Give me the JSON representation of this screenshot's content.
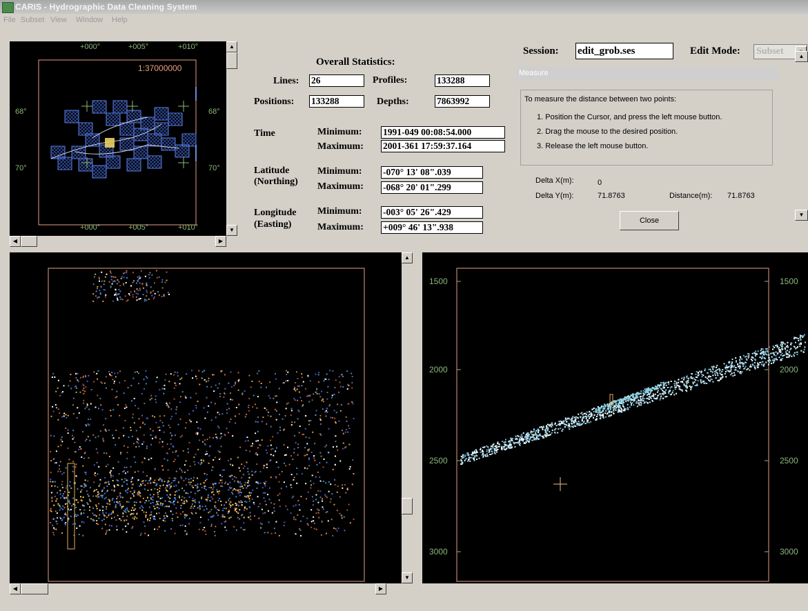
{
  "window": {
    "title": "CARIS - Hydrographic Data Cleaning System"
  },
  "menu": [
    "File",
    "Subset",
    "View",
    "Window",
    "Help"
  ],
  "overview": {
    "lon_labels": [
      "+000°",
      "+005°",
      "+010°"
    ],
    "lat_labels": [
      "68°",
      "70°"
    ],
    "scale": "1:37000000"
  },
  "stats": {
    "title": "Overall Statistics:",
    "lines_label": "Lines:",
    "lines": "26",
    "profiles_label": "Profiles:",
    "profiles": "133288",
    "positions_label": "Positions:",
    "positions": "133288",
    "depths_label": "Depths:",
    "depths": "7863992",
    "time_label": "Time",
    "latitude_label": "Latitude",
    "latitude_sub": "(Northing)",
    "longitude_label": "Longitude",
    "longitude_sub": "(Easting)",
    "min_label": "Minimum:",
    "max_label": "Maximum:",
    "time_min": "1991-049 00:08:54.000",
    "time_max": "2001-361 17:59:37.164",
    "lat_min": "-070° 13' 08\".039",
    "lat_max": "-068° 20' 01\".299",
    "lon_min": "-003° 05' 26\".429",
    "lon_max": "+009° 46' 13\".938"
  },
  "session": {
    "label": "Session:",
    "value": "edit_grob.ses",
    "edit_mode_label": "Edit Mode:",
    "edit_mode_value": "Subset"
  },
  "measure": {
    "title": "Measure",
    "intro": "To measure the distance between two points:",
    "steps": [
      "1. Position the Cursor, and press the left mouse button.",
      "2. Drag the mouse to the desired position.",
      "3. Release the left mouse button."
    ],
    "delta_x_label": "Delta X(m):",
    "delta_x": "0",
    "delta_y_label": "Delta Y(m):",
    "delta_y": "71.8763",
    "distance_label": "Distance(m):",
    "distance": "71.8763",
    "close_label": "Close"
  },
  "profile": {
    "y_ticks": [
      "1500",
      "2000",
      "2500",
      "3000"
    ]
  },
  "colors": {
    "frame": "#e8a080",
    "grid_label": "#8cb87a",
    "subset_cell": "#3a5ab8",
    "cursor": "#f0c090"
  }
}
